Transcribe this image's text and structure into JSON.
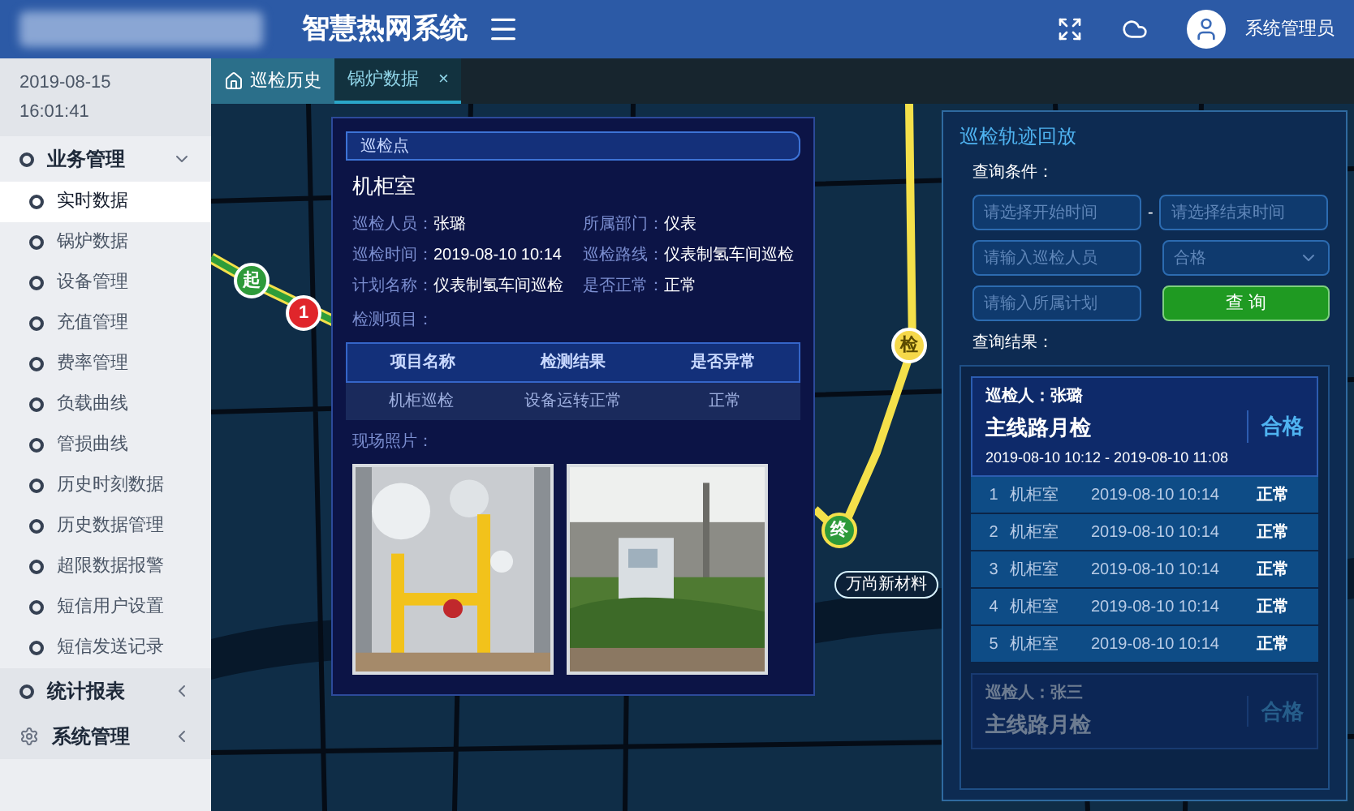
{
  "header": {
    "title": "智慧热网系统",
    "user": "系统管理员"
  },
  "sidebar": {
    "date": "2019-08-15",
    "time": "16:01:41",
    "groups": [
      {
        "label": "业务管理",
        "expanded": true,
        "children": [
          {
            "label": "实时数据",
            "selected": true
          },
          {
            "label": "锅炉数据",
            "selected": false
          },
          {
            "label": "设备管理",
            "selected": false
          },
          {
            "label": "充值管理",
            "selected": false
          },
          {
            "label": "费率管理",
            "selected": false
          },
          {
            "label": "负载曲线",
            "selected": false
          },
          {
            "label": "管损曲线",
            "selected": false
          },
          {
            "label": "历史时刻数据",
            "selected": false
          },
          {
            "label": "历史数据管理",
            "selected": false
          },
          {
            "label": "超限数据报警",
            "selected": false
          },
          {
            "label": "短信用户设置",
            "selected": false
          },
          {
            "label": "短信发送记录",
            "selected": false
          }
        ]
      },
      {
        "label": "统计报表",
        "expanded": false,
        "kind": "ring"
      },
      {
        "label": "系统管理",
        "expanded": false,
        "kind": "gear"
      }
    ]
  },
  "tabs": [
    {
      "label": "巡检历史",
      "selected": true
    },
    {
      "label": "锅炉数据",
      "selected": false,
      "close": "×"
    }
  ],
  "map": {
    "markers": [
      {
        "kind": "start",
        "label": "起"
      },
      {
        "kind": "number",
        "label": "1"
      },
      {
        "kind": "check",
        "label": "检"
      },
      {
        "kind": "end",
        "label": "终"
      }
    ],
    "place_label": "万尚新材料"
  },
  "dialog": {
    "header": "巡检点",
    "title": "机柜室",
    "fields": [
      {
        "label": "巡检人员：",
        "value": "张璐"
      },
      {
        "label": "所属部门：",
        "value": "仪表"
      },
      {
        "label": "巡检时间：",
        "value": "2019-08-10 10:14"
      },
      {
        "label": "巡检路线：",
        "value": "仪表制氢车间巡检"
      },
      {
        "label": "计划名称：",
        "value": "仪表制氢车间巡检"
      },
      {
        "label": "是否正常：",
        "value": "正常"
      }
    ],
    "items_label": "检测项目：",
    "table": {
      "columns": [
        "项目名称",
        "检测结果",
        "是否异常"
      ],
      "rows": [
        [
          "机柜巡检",
          "设备运转正常",
          "正常"
        ]
      ]
    },
    "photos_label": "现场照片："
  },
  "panel": {
    "title": "巡检轨迹回放",
    "query_label": "查询条件：",
    "start_time": {
      "placeholder": "请选择开始时间"
    },
    "separator": "-",
    "end_time": {
      "placeholder": "请选择结束时间"
    },
    "inspector": {
      "placeholder": "请输入巡检人员"
    },
    "result_filter": {
      "value": "合格"
    },
    "plan": {
      "placeholder": "请输入所属计划"
    },
    "search_button": "查 询",
    "results_label": "查询结果：",
    "results": [
      {
        "inspector": "巡检人：张璐",
        "route": "主线路月检",
        "status": "合格",
        "period": "2019-08-10 10:12 - 2019-08-10 11:08",
        "expanded": true,
        "rows": [
          {
            "index": "1",
            "point": "机柜室",
            "time": "2019-08-10 10:14",
            "status": "正常"
          },
          {
            "index": "2",
            "point": "机柜室",
            "time": "2019-08-10 10:14",
            "status": "正常"
          },
          {
            "index": "3",
            "point": "机柜室",
            "time": "2019-08-10 10:14",
            "status": "正常"
          },
          {
            "index": "4",
            "point": "机柜室",
            "time": "2019-08-10 10:14",
            "status": "正常"
          },
          {
            "index": "5",
            "point": "机柜室",
            "time": "2019-08-10 10:14",
            "status": "正常"
          }
        ]
      },
      {
        "inspector": "巡检人：张三",
        "route": "主线路月检",
        "status": "合格",
        "expanded": false
      }
    ]
  }
}
